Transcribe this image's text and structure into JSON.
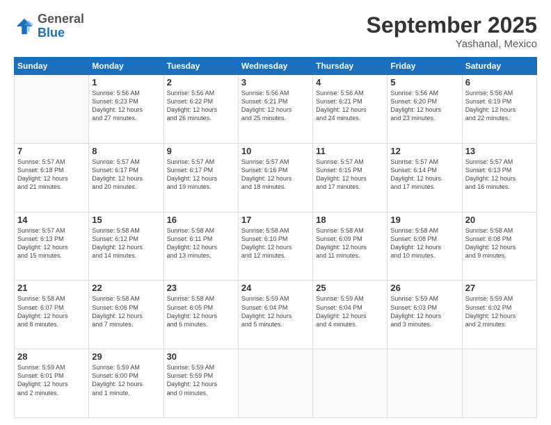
{
  "header": {
    "logo_line1": "General",
    "logo_line2": "Blue",
    "title": "September 2025",
    "subtitle": "Yashanal, Mexico"
  },
  "days_of_week": [
    "Sunday",
    "Monday",
    "Tuesday",
    "Wednesday",
    "Thursday",
    "Friday",
    "Saturday"
  ],
  "weeks": [
    [
      {
        "day": "",
        "info": ""
      },
      {
        "day": "1",
        "info": "Sunrise: 5:56 AM\nSunset: 6:23 PM\nDaylight: 12 hours\nand 27 minutes."
      },
      {
        "day": "2",
        "info": "Sunrise: 5:56 AM\nSunset: 6:22 PM\nDaylight: 12 hours\nand 26 minutes."
      },
      {
        "day": "3",
        "info": "Sunrise: 5:56 AM\nSunset: 6:21 PM\nDaylight: 12 hours\nand 25 minutes."
      },
      {
        "day": "4",
        "info": "Sunrise: 5:56 AM\nSunset: 6:21 PM\nDaylight: 12 hours\nand 24 minutes."
      },
      {
        "day": "5",
        "info": "Sunrise: 5:56 AM\nSunset: 6:20 PM\nDaylight: 12 hours\nand 23 minutes."
      },
      {
        "day": "6",
        "info": "Sunrise: 5:56 AM\nSunset: 6:19 PM\nDaylight: 12 hours\nand 22 minutes."
      }
    ],
    [
      {
        "day": "7",
        "info": "Sunrise: 5:57 AM\nSunset: 6:18 PM\nDaylight: 12 hours\nand 21 minutes."
      },
      {
        "day": "8",
        "info": "Sunrise: 5:57 AM\nSunset: 6:17 PM\nDaylight: 12 hours\nand 20 minutes."
      },
      {
        "day": "9",
        "info": "Sunrise: 5:57 AM\nSunset: 6:17 PM\nDaylight: 12 hours\nand 19 minutes."
      },
      {
        "day": "10",
        "info": "Sunrise: 5:57 AM\nSunset: 6:16 PM\nDaylight: 12 hours\nand 18 minutes."
      },
      {
        "day": "11",
        "info": "Sunrise: 5:57 AM\nSunset: 6:15 PM\nDaylight: 12 hours\nand 17 minutes."
      },
      {
        "day": "12",
        "info": "Sunrise: 5:57 AM\nSunset: 6:14 PM\nDaylight: 12 hours\nand 17 minutes."
      },
      {
        "day": "13",
        "info": "Sunrise: 5:57 AM\nSunset: 6:13 PM\nDaylight: 12 hours\nand 16 minutes."
      }
    ],
    [
      {
        "day": "14",
        "info": "Sunrise: 5:57 AM\nSunset: 6:13 PM\nDaylight: 12 hours\nand 15 minutes."
      },
      {
        "day": "15",
        "info": "Sunrise: 5:58 AM\nSunset: 6:12 PM\nDaylight: 12 hours\nand 14 minutes."
      },
      {
        "day": "16",
        "info": "Sunrise: 5:58 AM\nSunset: 6:11 PM\nDaylight: 12 hours\nand 13 minutes."
      },
      {
        "day": "17",
        "info": "Sunrise: 5:58 AM\nSunset: 6:10 PM\nDaylight: 12 hours\nand 12 minutes."
      },
      {
        "day": "18",
        "info": "Sunrise: 5:58 AM\nSunset: 6:09 PM\nDaylight: 12 hours\nand 11 minutes."
      },
      {
        "day": "19",
        "info": "Sunrise: 5:58 AM\nSunset: 6:08 PM\nDaylight: 12 hours\nand 10 minutes."
      },
      {
        "day": "20",
        "info": "Sunrise: 5:58 AM\nSunset: 6:08 PM\nDaylight: 12 hours\nand 9 minutes."
      }
    ],
    [
      {
        "day": "21",
        "info": "Sunrise: 5:58 AM\nSunset: 6:07 PM\nDaylight: 12 hours\nand 8 minutes."
      },
      {
        "day": "22",
        "info": "Sunrise: 5:58 AM\nSunset: 6:06 PM\nDaylight: 12 hours\nand 7 minutes."
      },
      {
        "day": "23",
        "info": "Sunrise: 5:58 AM\nSunset: 6:05 PM\nDaylight: 12 hours\nand 6 minutes."
      },
      {
        "day": "24",
        "info": "Sunrise: 5:59 AM\nSunset: 6:04 PM\nDaylight: 12 hours\nand 5 minutes."
      },
      {
        "day": "25",
        "info": "Sunrise: 5:59 AM\nSunset: 6:04 PM\nDaylight: 12 hours\nand 4 minutes."
      },
      {
        "day": "26",
        "info": "Sunrise: 5:59 AM\nSunset: 6:03 PM\nDaylight: 12 hours\nand 3 minutes."
      },
      {
        "day": "27",
        "info": "Sunrise: 5:59 AM\nSunset: 6:02 PM\nDaylight: 12 hours\nand 2 minutes."
      }
    ],
    [
      {
        "day": "28",
        "info": "Sunrise: 5:59 AM\nSunset: 6:01 PM\nDaylight: 12 hours\nand 2 minutes."
      },
      {
        "day": "29",
        "info": "Sunrise: 5:59 AM\nSunset: 6:00 PM\nDaylight: 12 hours\nand 1 minute."
      },
      {
        "day": "30",
        "info": "Sunrise: 5:59 AM\nSunset: 5:59 PM\nDaylight: 12 hours\nand 0 minutes."
      },
      {
        "day": "",
        "info": ""
      },
      {
        "day": "",
        "info": ""
      },
      {
        "day": "",
        "info": ""
      },
      {
        "day": "",
        "info": ""
      }
    ]
  ]
}
